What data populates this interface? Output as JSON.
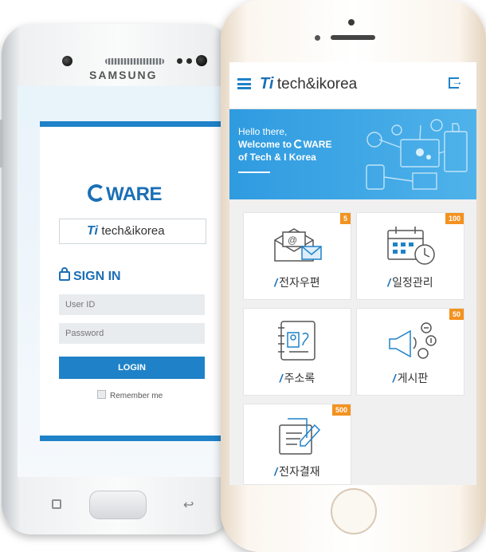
{
  "samsung": {
    "brand": "SAMSUNG",
    "logo_text": "WARE",
    "company_mark": "Ti",
    "company_text": "tech&ikorea",
    "signin_title": "SIGN IN",
    "user_id_placeholder": "User ID",
    "password_placeholder": "Password",
    "login_label": "LOGIN",
    "remember_label": "Remember me"
  },
  "iphone": {
    "header": {
      "logo_mark": "Ti",
      "logo_text": "tech&ikorea"
    },
    "banner": {
      "line1": "Hello there,",
      "line2": "Welcome to ",
      "line2_logo": "WARE",
      "line3": "of Tech & I Korea"
    },
    "tiles": [
      {
        "label": "전자우편",
        "badge": "5",
        "icon": "mail-icon"
      },
      {
        "label": "일정관리",
        "badge": "100",
        "icon": "calendar-icon"
      },
      {
        "label": "주소록",
        "badge": "",
        "icon": "address-book-icon"
      },
      {
        "label": "게시판",
        "badge": "50",
        "icon": "megaphone-icon"
      },
      {
        "label": "전자결재",
        "badge": "500",
        "icon": "document-edit-icon"
      }
    ]
  },
  "colors": {
    "brand_blue": "#1f82c8",
    "badge_orange": "#f39220"
  }
}
